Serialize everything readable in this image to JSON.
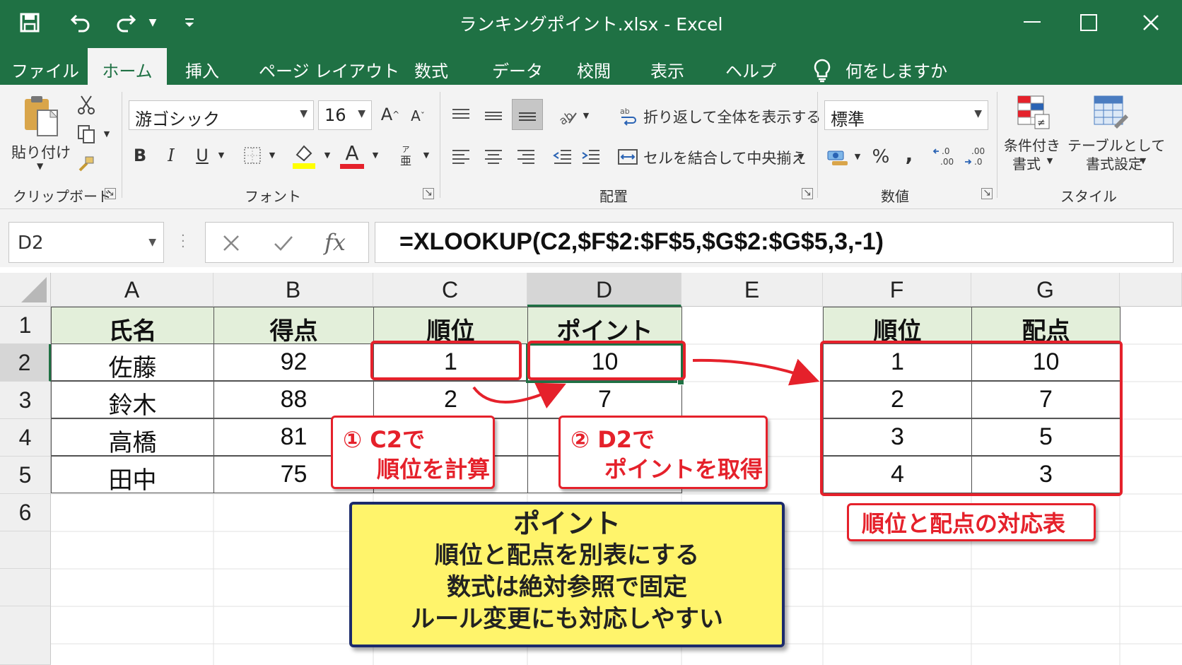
{
  "window": {
    "title": "ランキングポイント.xlsx  -  Excel",
    "quick_access": [
      "save-icon",
      "undo-icon",
      "redo-icon",
      "customize-icon"
    ],
    "controls": [
      "minimize-icon",
      "maximize-icon",
      "close-icon"
    ]
  },
  "tabs": {
    "file": "ファイル",
    "home": "ホーム",
    "insert": "挿入",
    "page_layout": "ページ レイアウト",
    "formulas": "数式",
    "data": "データ",
    "review": "校閲",
    "view": "表示",
    "help": "ヘルプ",
    "tell_me": "何をしますか"
  },
  "ribbon": {
    "clipboard": {
      "paste": "貼り付け",
      "label": "クリップボード"
    },
    "font": {
      "name": "游ゴシック",
      "size": "16",
      "label": "フォント",
      "bold": "B",
      "italic": "I",
      "underline": "U",
      "grow": "A",
      "shrink": "A",
      "phonetic": "亜",
      "font_color": "A"
    },
    "alignment": {
      "wrap": "折り返して全体を表示する",
      "merge": "セルを結合して中央揃え",
      "label": "配置"
    },
    "number": {
      "format": "標準",
      "percent": "%",
      "comma": ",",
      "inc_dec": "←.0 .00",
      "dec_dec": ".00 →.0",
      "label": "数値"
    },
    "styles": {
      "conditional": "条件付き\n書式",
      "conditional_l1": "条件付き",
      "conditional_l2": "書式",
      "table_l1": "テーブルとして",
      "table_l2": "書式設定",
      "label": "スタイル"
    }
  },
  "formula_bar": {
    "name_box": "D2",
    "formula": "=XLOOKUP(C2,$F$2:$F$5,$G$2:$G$5,3,-1)",
    "fx": "fx"
  },
  "grid": {
    "columns": [
      "A",
      "B",
      "C",
      "D",
      "E",
      "F",
      "G"
    ],
    "rows": [
      "1",
      "2",
      "3",
      "4",
      "5",
      "6"
    ],
    "headers": {
      "A": "氏名",
      "B": "得点",
      "C": "順位",
      "D": "ポイント",
      "F": "順位",
      "G": "配点"
    },
    "data": [
      {
        "name": "佐藤",
        "score": "92",
        "rank": "1",
        "point": "10"
      },
      {
        "name": "鈴木",
        "score": "88",
        "rank": "2",
        "point": "7"
      },
      {
        "name": "高橋",
        "score": "81",
        "rank": "",
        "point": ""
      },
      {
        "name": "田中",
        "score": "75",
        "rank": "",
        "point": ""
      }
    ],
    "lookup": [
      {
        "rank": "1",
        "points": "10"
      },
      {
        "rank": "2",
        "points": "7"
      },
      {
        "rank": "3",
        "points": "5"
      },
      {
        "rank": "4",
        "points": "3"
      }
    ]
  },
  "annotations": {
    "callout1_l1": "① C2で",
    "callout1_l2": "順位を計算",
    "callout2_l1": "② D2で",
    "callout2_l2": "ポイントを取得",
    "table_caption": "順位と配点の対応表",
    "point_title": "ポイント",
    "point_lines": [
      "順位と配点を別表にする",
      "数式は絶対参照で固定",
      "ルール変更にも対応しやすい"
    ],
    "accent_red": "#e5212b",
    "excel_green": "#1f7144",
    "note_yellow": "#fff46b"
  }
}
